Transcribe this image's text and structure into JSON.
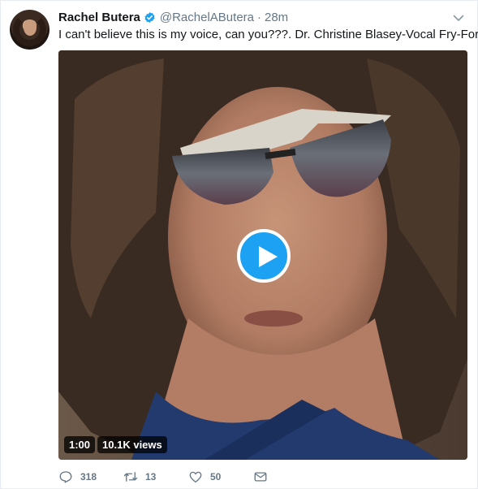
{
  "tweet": {
    "display_name": "Rachel Butera",
    "handle": "@RachelAButera",
    "separator": "·",
    "timestamp": "28m",
    "text": "I can't believe this is my voice, can you???. Dr. Christine Blasey-Vocal Fry-Ford.",
    "verified": true
  },
  "video": {
    "duration": "1:00",
    "views": "10.1K views"
  },
  "actions": {
    "reply_count": "318",
    "retweet_count": "13",
    "like_count": "50"
  },
  "icons": {
    "verified": "verified-badge-icon",
    "more": "chevron-down-icon",
    "play": "play-icon",
    "reply": "reply-icon",
    "retweet": "retweet-icon",
    "like": "heart-icon",
    "dm": "envelope-icon"
  },
  "colors": {
    "accent": "#1da1f2",
    "secondary_text": "#657786",
    "primary_text": "#14171a"
  }
}
